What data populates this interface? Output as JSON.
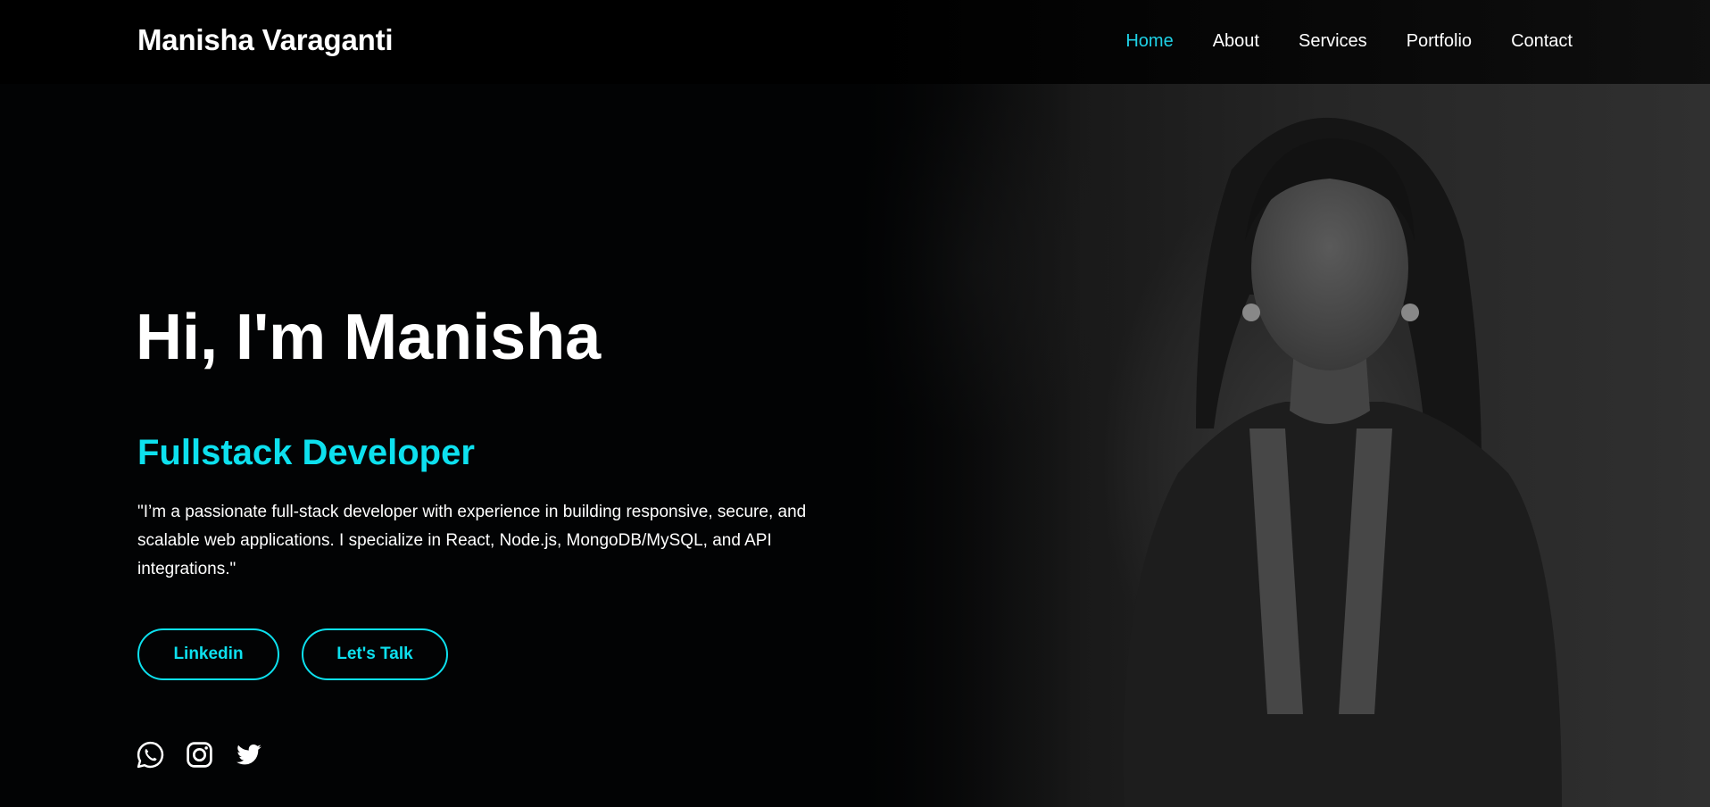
{
  "header": {
    "logo_text": "Manisha Varaganti",
    "nav": [
      {
        "label": "Home",
        "active": true
      },
      {
        "label": "About",
        "active": false
      },
      {
        "label": "Services",
        "active": false
      },
      {
        "label": "Portfolio",
        "active": false
      },
      {
        "label": "Contact",
        "active": false
      }
    ]
  },
  "hero": {
    "title": "Hi, I'm Manisha",
    "role": "Fullstack Developer",
    "description": "\"I’m a passionate full-stack developer with experience in building responsive, secure, and scalable web applications. I specialize in React, Node.js, MongoDB/MySQL, and API integrations.\"",
    "buttons": {
      "linkedin": "Linkedin",
      "talk": "Let's Talk"
    },
    "socials": [
      "whatsapp-icon",
      "instagram-icon",
      "twitter-icon"
    ]
  },
  "colors": {
    "accent": "#0de0ee",
    "background": "#020304",
    "text": "#ffffff"
  }
}
